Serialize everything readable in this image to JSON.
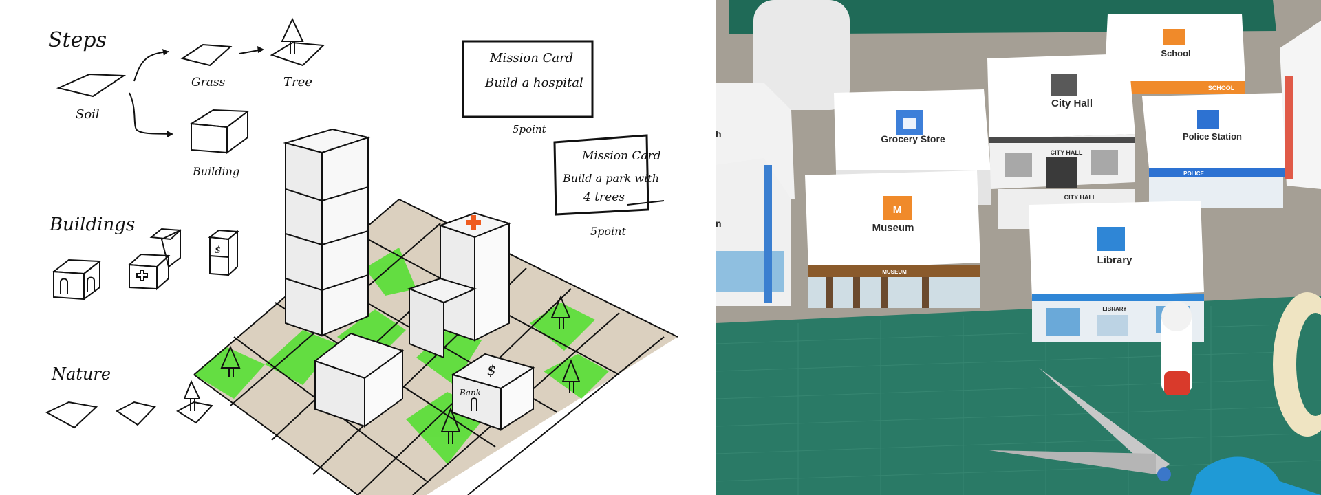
{
  "sketch": {
    "steps_heading": "Steps",
    "soil_label": "Soil",
    "grass_label": "Grass",
    "tree_label": "Tree",
    "building_label": "Building",
    "buildings_heading": "Buildings",
    "nature_heading": "Nature",
    "bank_label": "Bank",
    "bank_symbol": "$",
    "mission_cards": [
      {
        "title": "Mission Card",
        "line1": "Build a hospital",
        "line2": "",
        "points": "5point"
      },
      {
        "title": "Mission Card",
        "line1": "Build a park with",
        "line2": "4 trees",
        "points": "5point"
      }
    ],
    "colors": {
      "grass": "#4fe02c",
      "soil": "#d7cbb8",
      "hospital_cross": "#ef5b1e"
    }
  },
  "photo": {
    "buildings": [
      {
        "name": "Grocery Store",
        "icon": "shopping-bag-icon",
        "icon_color": "#3d7fd9"
      },
      {
        "name": "City Hall",
        "icon": "city-hall-icon",
        "icon_color": "#595959",
        "facade": "CITY HALL",
        "facade2": "CITY HALL"
      },
      {
        "name": "School",
        "icon": "graduation-cap-icon",
        "icon_color": "#f08a2a",
        "facade": "SCHOOL"
      },
      {
        "name": "Police Station",
        "icon": "police-badge-icon",
        "icon_color": "#2d72d2",
        "facade": "POLICE"
      },
      {
        "name": "Museum",
        "icon": "museum-icon",
        "icon_color": "#f08a2a",
        "icon_glyph": "M",
        "facade": "MUSEUM"
      },
      {
        "name": "Library",
        "icon": "book-icon",
        "icon_color": "#2f86d6",
        "facade": "LIBRARY"
      }
    ],
    "partial_labels": [
      "h",
      "n"
    ]
  }
}
